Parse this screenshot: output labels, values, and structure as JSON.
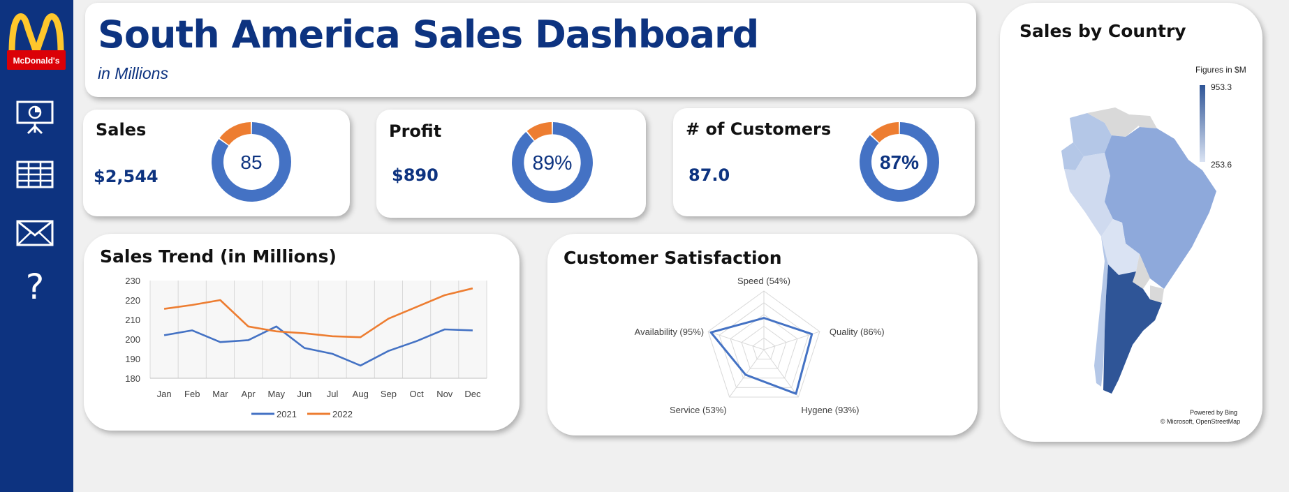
{
  "header": {
    "title": "South America Sales Dashboard",
    "subtitle": "in Millions"
  },
  "logo": {
    "text": "McDonald's"
  },
  "sidebar": {
    "items": [
      {
        "icon": "presentation-chart-icon"
      },
      {
        "icon": "table-grid-icon"
      },
      {
        "icon": "envelope-icon"
      },
      {
        "icon": "question-mark-icon",
        "label": "?"
      }
    ]
  },
  "kpis": {
    "sales": {
      "label": "Sales",
      "value": "$2,544",
      "center": "85",
      "fraction": 0.85
    },
    "profit": {
      "label": "Profit",
      "value": "$890",
      "center": "89%",
      "fraction": 0.89
    },
    "customers": {
      "label": "# of Customers",
      "value": "87.0",
      "center": "87%",
      "fraction": 0.87
    }
  },
  "colors": {
    "navy": "#0d3380",
    "blue": "#4472c4",
    "orange": "#ed7d31",
    "line2021": "#4472c4",
    "line2022": "#ed7d31"
  },
  "chart_data": [
    {
      "type": "line",
      "title": "Sales Trend (in Millions)",
      "categories": [
        "Jan",
        "Feb",
        "Mar",
        "Apr",
        "May",
        "Jun",
        "Jul",
        "Aug",
        "Sep",
        "Oct",
        "Nov",
        "Dec"
      ],
      "series": [
        {
          "name": "2021",
          "values": [
            202,
            204.5,
            198.5,
            199.5,
            206.5,
            195.5,
            192.5,
            186.5,
            194,
            199,
            205,
            204.5
          ]
        },
        {
          "name": "2022",
          "values": [
            215.5,
            217.5,
            220,
            206.5,
            204,
            203,
            201.5,
            201,
            210.5,
            216.5,
            222.5,
            226
          ]
        }
      ],
      "ylim": [
        180,
        230
      ],
      "yticks": [
        "180",
        "190",
        "200",
        "210",
        "220",
        "230"
      ],
      "grid": "vertical",
      "legend": "bottom"
    },
    {
      "type": "radar",
      "title": "Customer Satisfaction",
      "categories": [
        "Speed (54%)",
        "Quality (86%)",
        "Hygene (93%)",
        "Service (53%)",
        "Availability (95%)"
      ],
      "values": [
        54,
        86,
        93,
        53,
        95
      ],
      "range": [
        0,
        100
      ]
    },
    {
      "type": "choropleth",
      "title": "Sales by Country",
      "legend_title": "Figures in $M",
      "range": [
        253.6,
        953.3
      ],
      "range_labels": [
        "953.3",
        "253.6"
      ],
      "credits": [
        "Powered by Bing",
        "© Microsoft, OpenStreetMap"
      ]
    }
  ]
}
